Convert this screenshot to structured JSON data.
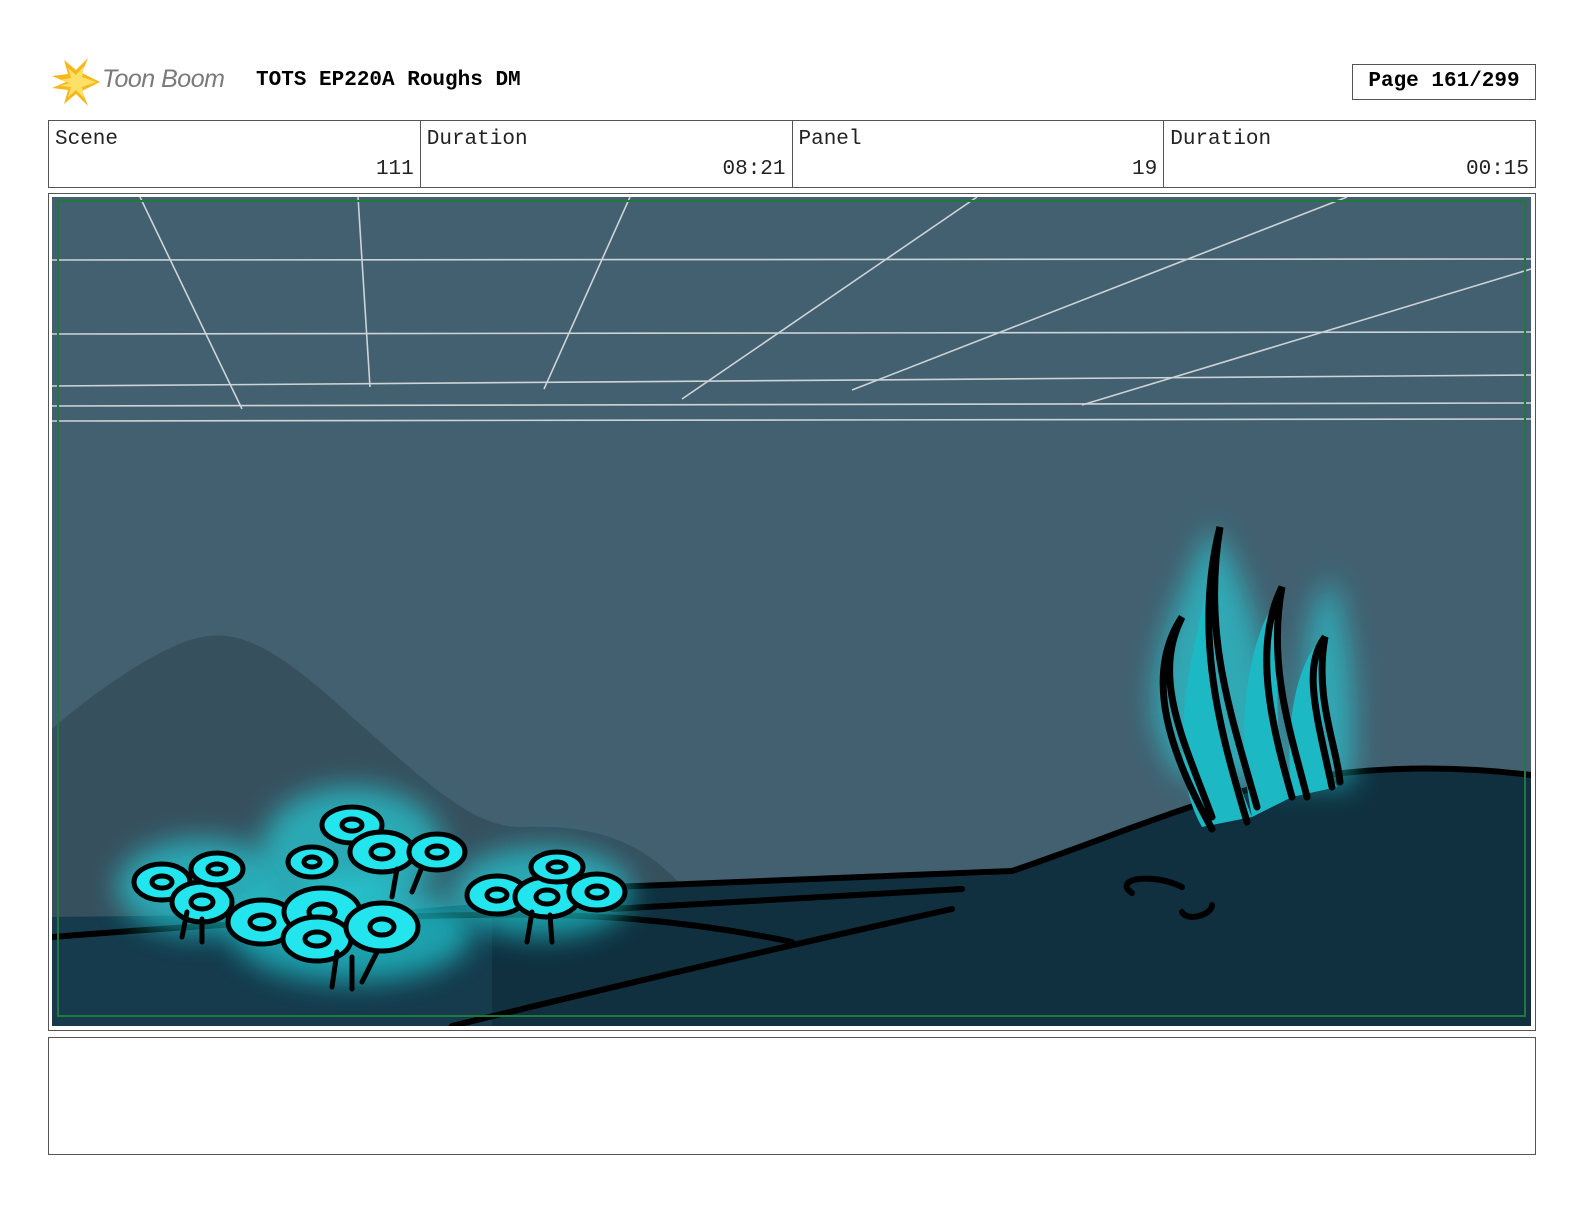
{
  "header": {
    "logo_text": "Toon Boom",
    "title": "TOTS EP220A Roughs DM",
    "page_label": "Page 161/299"
  },
  "info": [
    {
      "label": "Scene",
      "value": "111"
    },
    {
      "label": "Duration",
      "value": "08:21"
    },
    {
      "label": "Panel",
      "value": "19"
    },
    {
      "label": "Duration",
      "value": "00:15"
    }
  ],
  "colors": {
    "water": "#426070",
    "hill": "#37505e",
    "seafloor": "#10303f",
    "glow": "#22e5ee",
    "safe_frame": "#1f7a3a"
  },
  "notes": ""
}
